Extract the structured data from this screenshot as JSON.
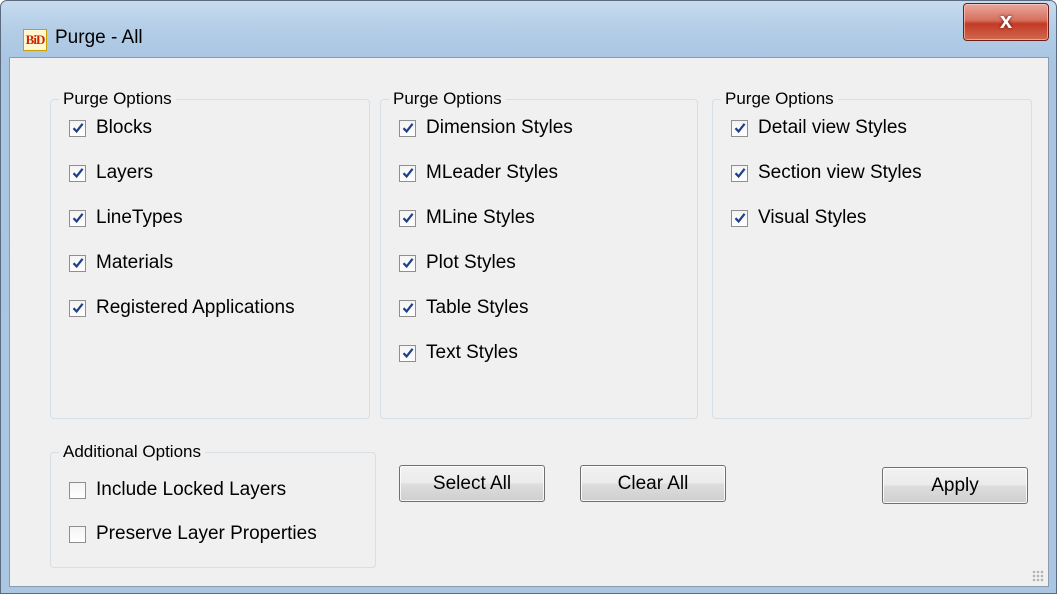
{
  "window": {
    "title": "Purge - All",
    "app_icon_text": "BiD",
    "close_label": "x"
  },
  "groups": [
    {
      "legend": "Purge Options",
      "items": [
        {
          "label": "Blocks",
          "checked": true
        },
        {
          "label": "Layers",
          "checked": true
        },
        {
          "label": "LineTypes",
          "checked": true
        },
        {
          "label": "Materials",
          "checked": true
        },
        {
          "label": "Registered Applications",
          "checked": true
        }
      ]
    },
    {
      "legend": "Purge Options",
      "items": [
        {
          "label": "Dimension Styles",
          "checked": true
        },
        {
          "label": "MLeader Styles",
          "checked": true
        },
        {
          "label": "MLine Styles",
          "checked": true
        },
        {
          "label": "Plot Styles",
          "checked": true
        },
        {
          "label": "Table Styles",
          "checked": true
        },
        {
          "label": "Text Styles",
          "checked": true
        }
      ]
    },
    {
      "legend": "Purge Options",
      "items": [
        {
          "label": "Detail view Styles",
          "checked": true
        },
        {
          "label": "Section view Styles",
          "checked": true
        },
        {
          "label": "Visual Styles",
          "checked": true
        }
      ]
    }
  ],
  "additional": {
    "legend": "Additional Options",
    "items": [
      {
        "label": "Include Locked Layers",
        "checked": false
      },
      {
        "label": "Preserve Layer Properties",
        "checked": false
      }
    ]
  },
  "buttons": {
    "select_all": "Select All",
    "clear_all": "Clear All",
    "apply": "Apply"
  },
  "colors": {
    "check_mark": "#1e3f8a",
    "close_button": "#c43a26"
  }
}
